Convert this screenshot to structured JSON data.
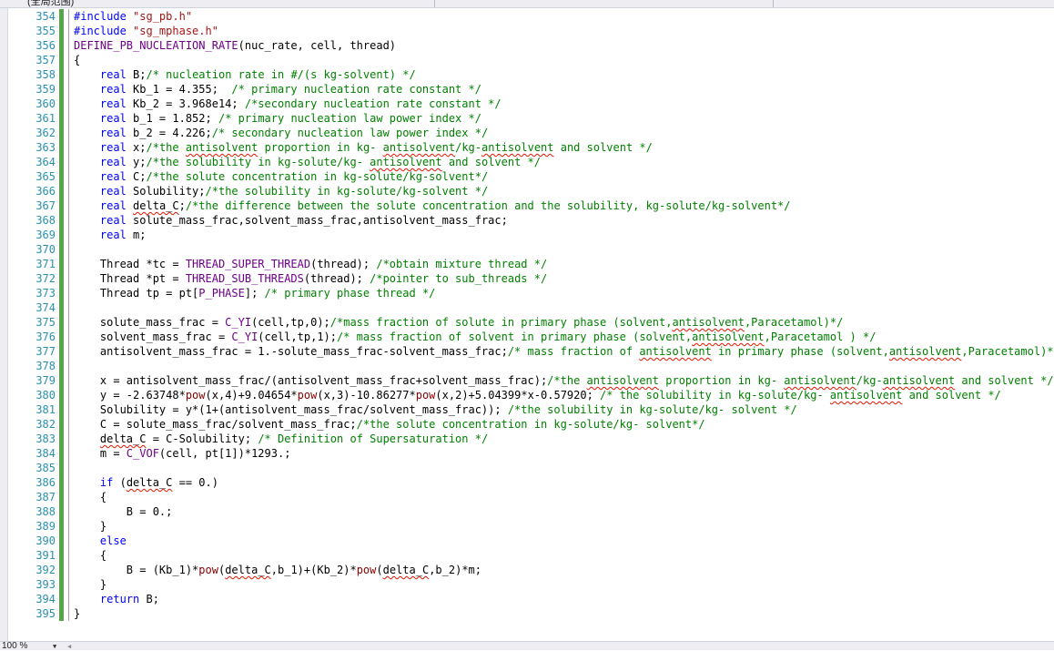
{
  "window": {
    "tab_label": "(全局范围)"
  },
  "status_bar": {
    "zoom": "100 %",
    "zoom_dropdown_icon": "chevron-down-icon",
    "scroll_left_icon": "chevron-left-icon"
  },
  "colors": {
    "keyword": "#0000ff",
    "preprocessor": "#808080",
    "string": "#a31515",
    "macro": "#6f008a",
    "comment": "#008000",
    "function": "#880000",
    "line_number": "#2b91af",
    "change_marker": "#57a64a",
    "squiggle": "#e51400"
  },
  "editor": {
    "lines": [
      {
        "n": "354",
        "tokens": [
          {
            "t": "#include ",
            "c": "kw"
          },
          {
            "t": "\"sg_pb.h\"",
            "c": "str"
          }
        ]
      },
      {
        "n": "355",
        "tokens": [
          {
            "t": "#include ",
            "c": "kw"
          },
          {
            "t": "\"sg_mphase.h\"",
            "c": "str"
          }
        ]
      },
      {
        "n": "356",
        "tokens": [
          {
            "t": "DEFINE_PB_NUCLEATION_RATE",
            "c": "mac"
          },
          {
            "t": "(nuc_rate, cell, thread)"
          }
        ]
      },
      {
        "n": "357",
        "tokens": [
          {
            "t": "{"
          }
        ]
      },
      {
        "n": "358",
        "tokens": [
          {
            "t": "    "
          },
          {
            "t": "real",
            "c": "kw"
          },
          {
            "t": " B;"
          },
          {
            "t": "/* nucleation rate in #/(s kg-solvent) */",
            "c": "cm"
          }
        ]
      },
      {
        "n": "359",
        "tokens": [
          {
            "t": "    "
          },
          {
            "t": "real",
            "c": "kw"
          },
          {
            "t": " Kb_1 = 4.355;  "
          },
          {
            "t": "/* primary nucleation rate constant */",
            "c": "cm"
          }
        ]
      },
      {
        "n": "360",
        "tokens": [
          {
            "t": "    "
          },
          {
            "t": "real",
            "c": "kw"
          },
          {
            "t": " Kb_2 = 3.968e14; "
          },
          {
            "t": "/*secondary nucleation rate constant */",
            "c": "cm"
          }
        ]
      },
      {
        "n": "361",
        "tokens": [
          {
            "t": "    "
          },
          {
            "t": "real",
            "c": "kw"
          },
          {
            "t": " b_1 = 1.852; "
          },
          {
            "t": "/* primary nucleation law power index */",
            "c": "cm"
          }
        ]
      },
      {
        "n": "362",
        "tokens": [
          {
            "t": "    "
          },
          {
            "t": "real",
            "c": "kw"
          },
          {
            "t": " b_2 = 4.226;"
          },
          {
            "t": "/* secondary nucleation law power index */",
            "c": "cm"
          }
        ]
      },
      {
        "n": "363",
        "tokens": [
          {
            "t": "    "
          },
          {
            "t": "real",
            "c": "kw"
          },
          {
            "t": " x;"
          },
          {
            "t": "/*the ",
            "c": "cm"
          },
          {
            "t": "antisolvent",
            "c": "cm",
            "sq": true
          },
          {
            "t": " proportion in kg- ",
            "c": "cm"
          },
          {
            "t": "antisolvent",
            "c": "cm",
            "sq": true
          },
          {
            "t": "/kg-",
            "c": "cm"
          },
          {
            "t": "antisolvent",
            "c": "cm",
            "sq": true
          },
          {
            "t": " and solvent */",
            "c": "cm"
          }
        ]
      },
      {
        "n": "364",
        "tokens": [
          {
            "t": "    "
          },
          {
            "t": "real",
            "c": "kw"
          },
          {
            "t": " y;"
          },
          {
            "t": "/*the solubility in kg-solute/kg- ",
            "c": "cm"
          },
          {
            "t": "antisolvent",
            "c": "cm",
            "sq": true
          },
          {
            "t": " and solvent */",
            "c": "cm"
          }
        ]
      },
      {
        "n": "365",
        "tokens": [
          {
            "t": "    "
          },
          {
            "t": "real",
            "c": "kw"
          },
          {
            "t": " C;"
          },
          {
            "t": "/*the solute concentration in kg-solute/kg-solvent*/",
            "c": "cm"
          }
        ]
      },
      {
        "n": "366",
        "tokens": [
          {
            "t": "    "
          },
          {
            "t": "real",
            "c": "kw"
          },
          {
            "t": " Solubility;"
          },
          {
            "t": "/*the solubility in kg-solute/kg-solvent */",
            "c": "cm"
          }
        ]
      },
      {
        "n": "367",
        "tokens": [
          {
            "t": "    "
          },
          {
            "t": "real",
            "c": "kw"
          },
          {
            "t": " "
          },
          {
            "t": "delta_C",
            "sq": true
          },
          {
            "t": ";"
          },
          {
            "t": "/*the difference between the solute concentration and the solubility, kg-solute/kg-solvent*/",
            "c": "cm"
          }
        ]
      },
      {
        "n": "368",
        "tokens": [
          {
            "t": "    "
          },
          {
            "t": "real",
            "c": "kw"
          },
          {
            "t": " solute_mass_frac,solvent_mass_frac,antisolvent_mass_frac;"
          }
        ]
      },
      {
        "n": "369",
        "tokens": [
          {
            "t": "    "
          },
          {
            "t": "real",
            "c": "kw"
          },
          {
            "t": " m;"
          }
        ]
      },
      {
        "n": "370",
        "tokens": []
      },
      {
        "n": "371",
        "tokens": [
          {
            "t": "    Thread *tc = "
          },
          {
            "t": "THREAD_SUPER_THREAD",
            "c": "mac"
          },
          {
            "t": "(thread); "
          },
          {
            "t": "/*obtain mixture thread */",
            "c": "cm"
          }
        ]
      },
      {
        "n": "372",
        "tokens": [
          {
            "t": "    Thread *pt = "
          },
          {
            "t": "THREAD_SUB_THREADS",
            "c": "mac"
          },
          {
            "t": "(thread); "
          },
          {
            "t": "/*pointer to sub_threads */",
            "c": "cm"
          }
        ]
      },
      {
        "n": "373",
        "tokens": [
          {
            "t": "    Thread tp = pt["
          },
          {
            "t": "P_PHASE",
            "c": "mac"
          },
          {
            "t": "]; "
          },
          {
            "t": "/* primary phase thread */",
            "c": "cm"
          }
        ]
      },
      {
        "n": "374",
        "tokens": []
      },
      {
        "n": "375",
        "tokens": [
          {
            "t": "    solute_mass_frac = "
          },
          {
            "t": "C_YI",
            "c": "mac"
          },
          {
            "t": "(cell,tp,0);"
          },
          {
            "t": "/*mass fraction of solute in primary phase (solvent,",
            "c": "cm"
          },
          {
            "t": "antisolvent",
            "c": "cm",
            "sq": true
          },
          {
            "t": ",Paracetamol)*/",
            "c": "cm"
          }
        ]
      },
      {
        "n": "376",
        "tokens": [
          {
            "t": "    solvent_mass_frac = "
          },
          {
            "t": "C_YI",
            "c": "mac"
          },
          {
            "t": "(cell,tp,1);"
          },
          {
            "t": "/* mass fraction of solvent in primary phase (solvent,",
            "c": "cm"
          },
          {
            "t": "antisolvent",
            "c": "cm",
            "sq": true
          },
          {
            "t": ",Paracetamol ) */",
            "c": "cm"
          }
        ]
      },
      {
        "n": "377",
        "tokens": [
          {
            "t": "    antisolvent_mass_frac = 1.-solute_mass_frac-solvent_mass_frac;"
          },
          {
            "t": "/* mass fraction of ",
            "c": "cm"
          },
          {
            "t": "antisolvent",
            "c": "cm",
            "sq": true
          },
          {
            "t": " in primary phase (solvent,",
            "c": "cm"
          },
          {
            "t": "antisolvent",
            "c": "cm",
            "sq": true
          },
          {
            "t": ",Paracetamol)*/",
            "c": "cm"
          }
        ]
      },
      {
        "n": "378",
        "tokens": []
      },
      {
        "n": "379",
        "tokens": [
          {
            "t": "    x = antisolvent_mass_frac/(antisolvent_mass_frac+solvent_mass_frac);"
          },
          {
            "t": "/*the ",
            "c": "cm"
          },
          {
            "t": "antisolvent",
            "c": "cm",
            "sq": true
          },
          {
            "t": " proportion in kg- ",
            "c": "cm"
          },
          {
            "t": "antisolvent",
            "c": "cm",
            "sq": true
          },
          {
            "t": "/kg-",
            "c": "cm"
          },
          {
            "t": "antisolvent",
            "c": "cm",
            "sq": true
          },
          {
            "t": " and solvent */",
            "c": "cm"
          }
        ]
      },
      {
        "n": "380",
        "tokens": [
          {
            "t": "    y = -2.63748*"
          },
          {
            "t": "pow",
            "c": "fn"
          },
          {
            "t": "(x,4)+9.04654*"
          },
          {
            "t": "pow",
            "c": "fn"
          },
          {
            "t": "(x,3)-10.86277*"
          },
          {
            "t": "pow",
            "c": "fn"
          },
          {
            "t": "(x,2)+5.04399*x-0.57920; "
          },
          {
            "t": "/* the solubility in kg-solute/kg- ",
            "c": "cm"
          },
          {
            "t": "antisolvent",
            "c": "cm",
            "sq": true
          },
          {
            "t": " and solvent */",
            "c": "cm"
          }
        ]
      },
      {
        "n": "381",
        "tokens": [
          {
            "t": "    Solubility = y*(1+(antisolvent_mass_frac/solvent_mass_frac)); "
          },
          {
            "t": "/*the solubility in kg-solute/kg- solvent */",
            "c": "cm"
          }
        ]
      },
      {
        "n": "382",
        "tokens": [
          {
            "t": "    C = solute_mass_frac/solvent_mass_frac;"
          },
          {
            "t": "/*the solute concentration in kg-solute/kg- solvent*/",
            "c": "cm"
          }
        ]
      },
      {
        "n": "383",
        "tokens": [
          {
            "t": "    "
          },
          {
            "t": "delta_C",
            "sq": true
          },
          {
            "t": " = C-Solubility; "
          },
          {
            "t": "/* Definition of Supersaturation */",
            "c": "cm"
          }
        ]
      },
      {
        "n": "384",
        "tokens": [
          {
            "t": "    m = "
          },
          {
            "t": "C_VOF",
            "c": "mac"
          },
          {
            "t": "(cell, pt[1])*1293.;"
          }
        ]
      },
      {
        "n": "385",
        "tokens": []
      },
      {
        "n": "386",
        "tokens": [
          {
            "t": "    "
          },
          {
            "t": "if",
            "c": "kw"
          },
          {
            "t": " ("
          },
          {
            "t": "delta_C",
            "sq": true
          },
          {
            "t": " == 0.)"
          }
        ]
      },
      {
        "n": "387",
        "tokens": [
          {
            "t": "    {"
          }
        ]
      },
      {
        "n": "388",
        "tokens": [
          {
            "t": "        B = 0.;"
          }
        ]
      },
      {
        "n": "389",
        "tokens": [
          {
            "t": "    }"
          }
        ]
      },
      {
        "n": "390",
        "tokens": [
          {
            "t": "    "
          },
          {
            "t": "else",
            "c": "kw"
          }
        ]
      },
      {
        "n": "391",
        "tokens": [
          {
            "t": "    {"
          }
        ]
      },
      {
        "n": "392",
        "tokens": [
          {
            "t": "        B = (Kb_1)*"
          },
          {
            "t": "pow",
            "c": "fn"
          },
          {
            "t": "("
          },
          {
            "t": "delta_C",
            "sq": true
          },
          {
            "t": ",b_1)+(Kb_2)*"
          },
          {
            "t": "pow",
            "c": "fn"
          },
          {
            "t": "("
          },
          {
            "t": "delta_C",
            "sq": true
          },
          {
            "t": ",b_2)*m;"
          }
        ]
      },
      {
        "n": "393",
        "tokens": [
          {
            "t": "    }"
          }
        ]
      },
      {
        "n": "394",
        "tokens": [
          {
            "t": "    "
          },
          {
            "t": "return",
            "c": "kw"
          },
          {
            "t": " B;"
          }
        ]
      },
      {
        "n": "395",
        "tokens": [
          {
            "t": "}"
          }
        ]
      }
    ]
  }
}
